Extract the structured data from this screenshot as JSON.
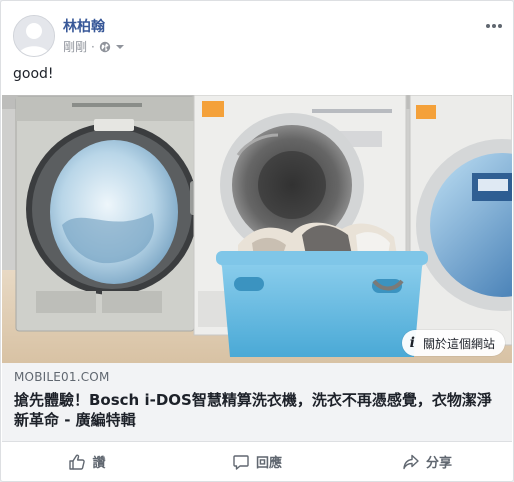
{
  "post": {
    "author": "林柏翰",
    "timestamp": "剛剛",
    "text": "good!"
  },
  "link": {
    "domain": "MOBILE01.COM",
    "title": "搶先體驗！Bosch i-DOS智慧精算洗衣機，洗衣不再憑感覺，衣物潔淨新革命 - 廣編特輯",
    "info_label": "關於這個網站"
  },
  "actions": {
    "like": "讚",
    "comment": "回應",
    "share": "分享"
  },
  "icons": {
    "privacy": "globe-icon",
    "dropdown": "chevron-down-icon",
    "more": "more-options-icon",
    "info": "info-icon",
    "like": "thumbs-up-icon",
    "comment": "comment-icon",
    "share": "share-icon"
  },
  "colors": {
    "author": "#385898",
    "meta": "#90949c",
    "link_bg": "#f2f3f5",
    "action_text": "#606770"
  }
}
